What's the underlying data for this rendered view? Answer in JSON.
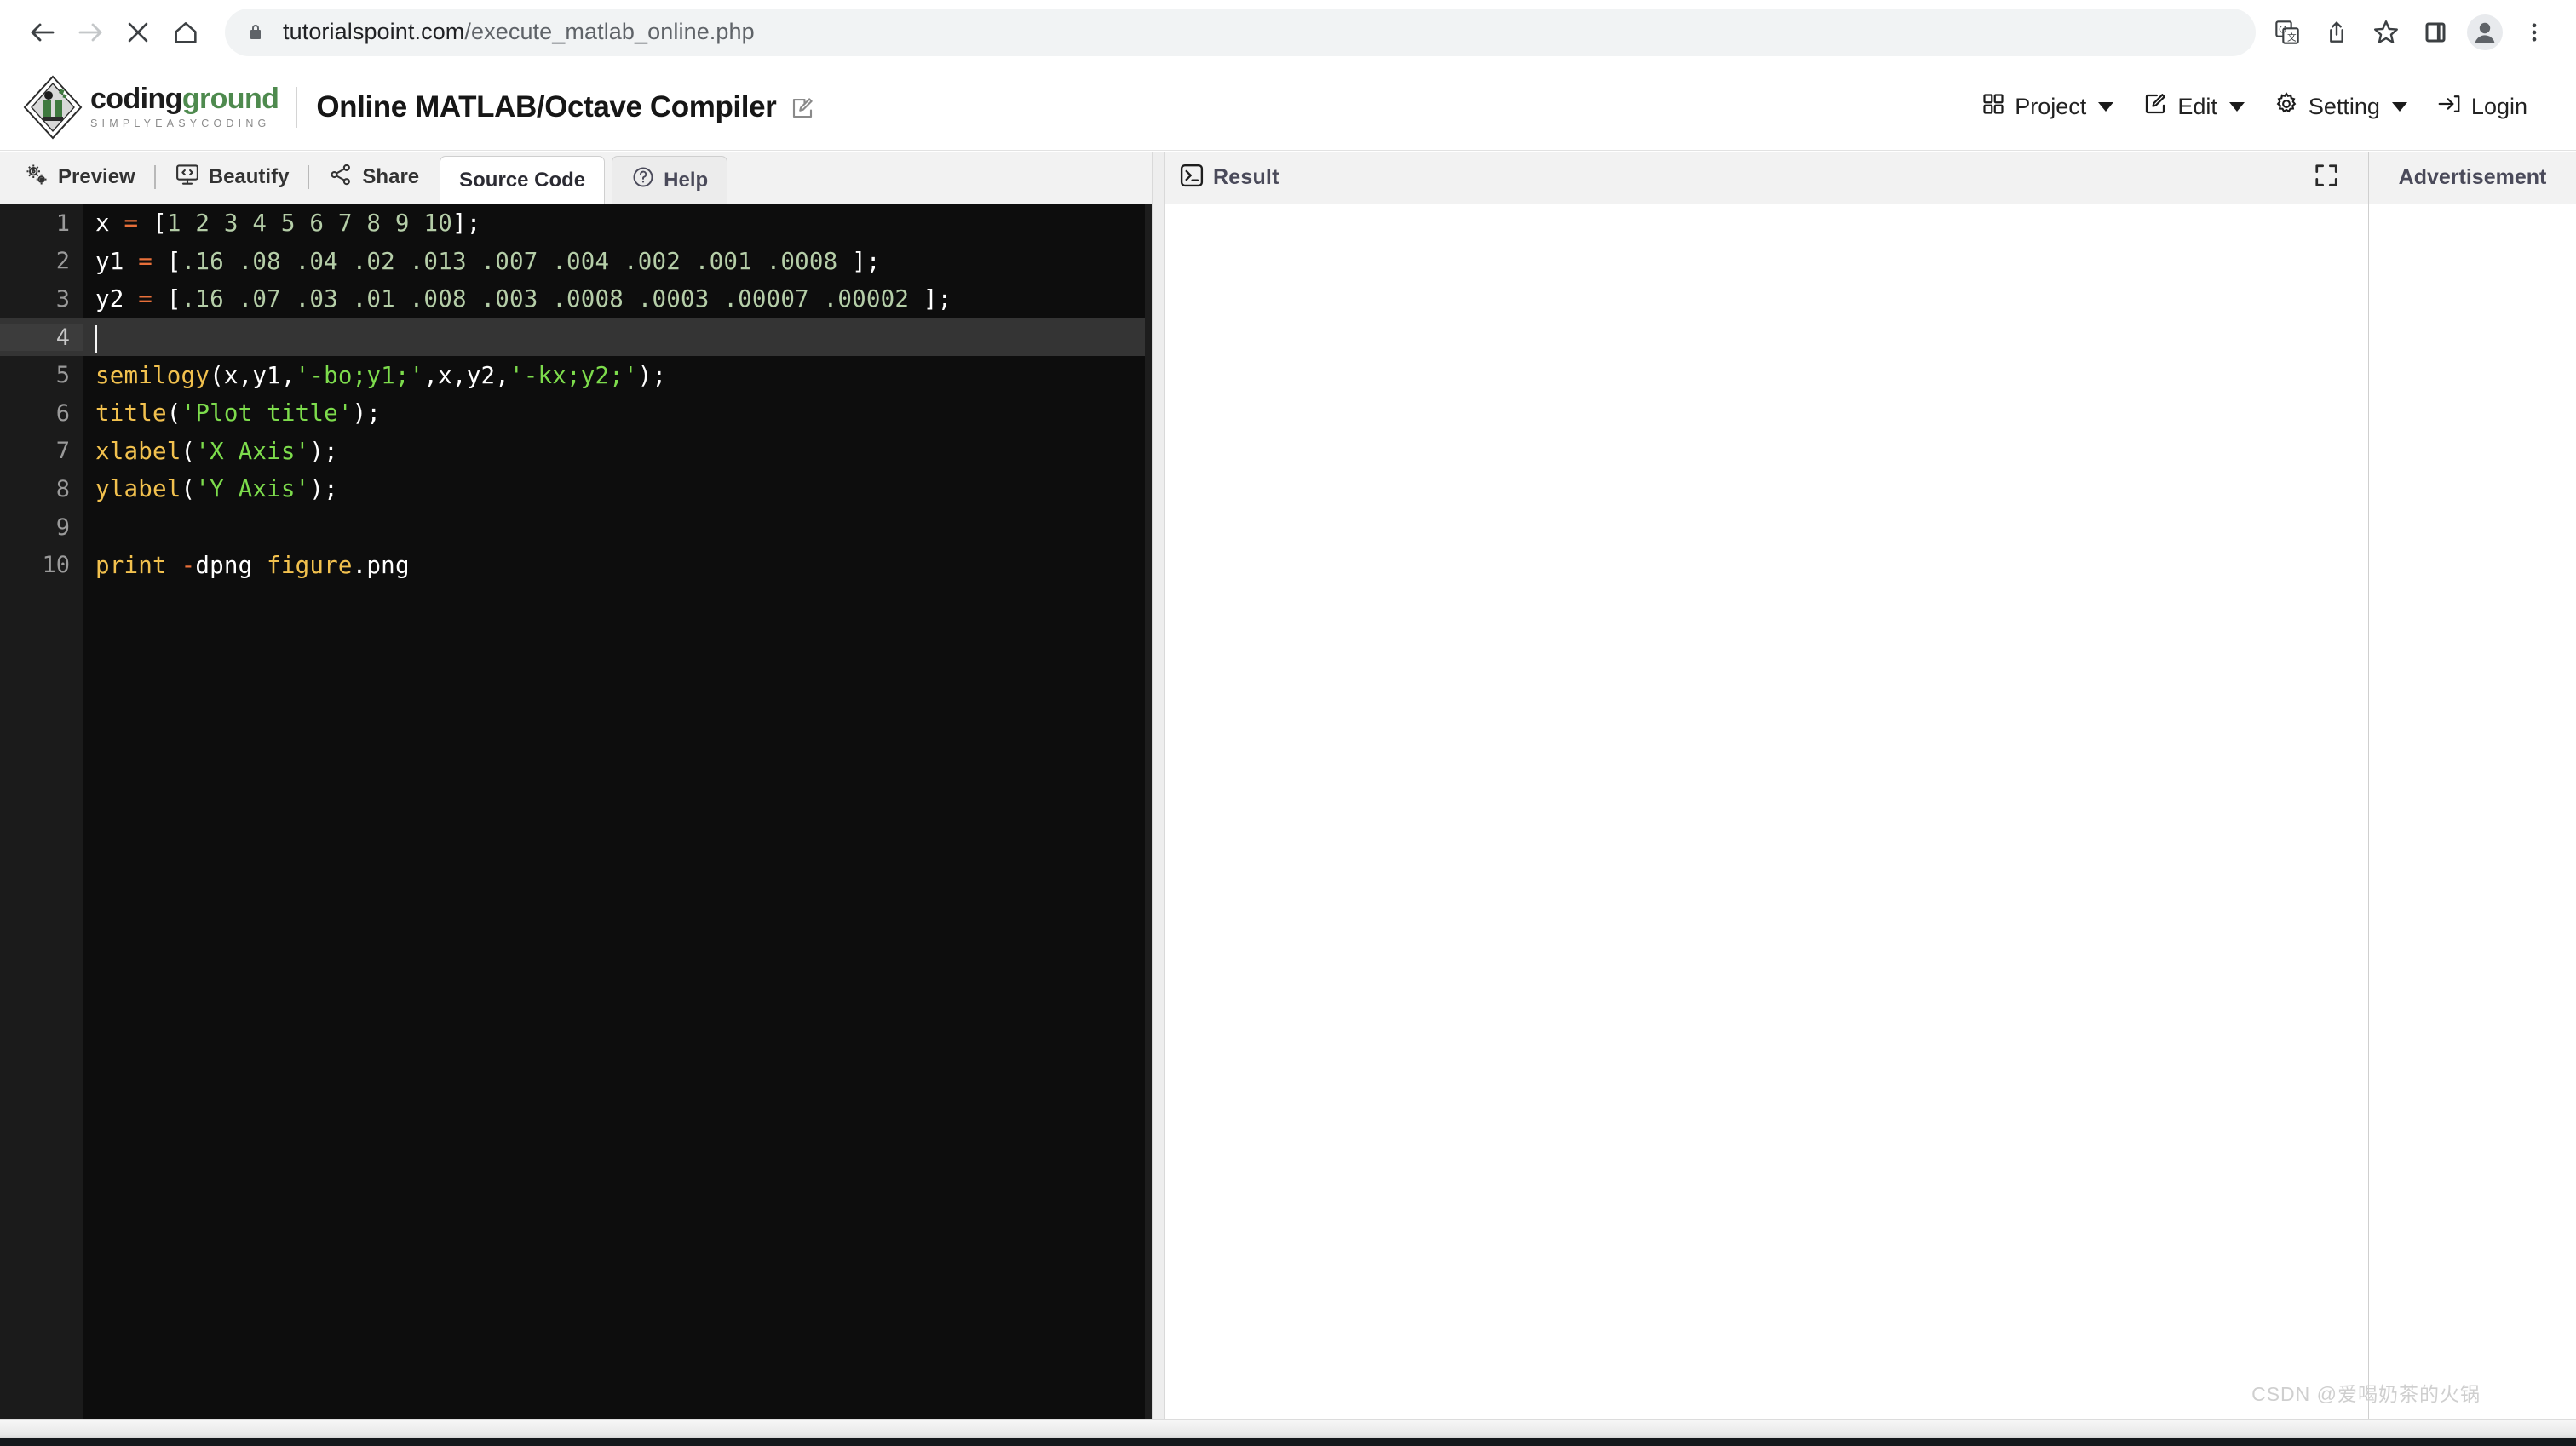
{
  "browser": {
    "url_domain": "tutorialspoint.com",
    "url_path": "/execute_matlab_online.php",
    "back_icon": "back-arrow-icon",
    "forward_icon": "forward-arrow-icon",
    "stop_icon": "stop-x-icon",
    "home_icon": "home-icon",
    "lock_icon": "lock-icon",
    "translate_icon": "translate-icon",
    "share_icon": "share-icon",
    "bookmark_icon": "star-icon",
    "sidepanel_icon": "side-panel-icon",
    "profile_icon": "profile-avatar-icon",
    "menu_icon": "three-dot-menu-icon"
  },
  "header": {
    "brand_name_part1": "coding",
    "brand_name_part2": "ground",
    "brand_tagline": "SIMPLYEASYCODING",
    "app_title": "Online MATLAB/Octave Compiler",
    "edit_title_icon": "pencil-square-icon",
    "nav": [
      {
        "label": "Project",
        "icon": "grid-squares-icon",
        "has_caret": true
      },
      {
        "label": "Edit",
        "icon": "pencil-square-icon",
        "has_caret": true
      },
      {
        "label": "Setting",
        "icon": "gear-icon",
        "has_caret": true
      },
      {
        "label": "Login",
        "icon": "login-arrow-icon",
        "has_caret": false
      }
    ]
  },
  "toolbar": {
    "buttons": [
      {
        "label": "Preview",
        "icon": "gears-icon"
      },
      {
        "label": "Beautify",
        "icon": "monitor-code-icon"
      },
      {
        "label": "Share",
        "icon": "share-nodes-icon"
      }
    ],
    "tabs": [
      {
        "label": "Source Code",
        "icon": "",
        "active": true
      },
      {
        "label": "Help",
        "icon": "question-circle-icon",
        "active": false
      }
    ]
  },
  "editor": {
    "active_line": 4,
    "lines": [
      {
        "n": "1",
        "tokens": [
          {
            "t": "var",
            "v": "x"
          },
          {
            "t": "plain",
            "v": " "
          },
          {
            "t": "op",
            "v": "="
          },
          {
            "t": "plain",
            "v": " "
          },
          {
            "t": "punc",
            "v": "["
          },
          {
            "t": "num",
            "v": "1 2 3 4 5 6 7 8 9 10"
          },
          {
            "t": "punc",
            "v": "];"
          }
        ]
      },
      {
        "n": "2",
        "tokens": [
          {
            "t": "var",
            "v": "y1"
          },
          {
            "t": "plain",
            "v": " "
          },
          {
            "t": "op",
            "v": "="
          },
          {
            "t": "plain",
            "v": " "
          },
          {
            "t": "punc",
            "v": "["
          },
          {
            "t": "num",
            "v": ".16 .08 .04 .02 .013 .007 .004 .002 .001 .0008 "
          },
          {
            "t": "punc",
            "v": "];"
          }
        ]
      },
      {
        "n": "3",
        "tokens": [
          {
            "t": "var",
            "v": "y2"
          },
          {
            "t": "plain",
            "v": " "
          },
          {
            "t": "op",
            "v": "="
          },
          {
            "t": "plain",
            "v": " "
          },
          {
            "t": "punc",
            "v": "["
          },
          {
            "t": "num",
            "v": ".16 .07 .03 .01 .008 .003 .0008 .0003 .00007 .00002 "
          },
          {
            "t": "punc",
            "v": "];"
          }
        ]
      },
      {
        "n": "4",
        "tokens": []
      },
      {
        "n": "5",
        "tokens": [
          {
            "t": "fn",
            "v": "semilogy"
          },
          {
            "t": "punc",
            "v": "(x,y1,"
          },
          {
            "t": "str",
            "v": "'-bo;y1;'"
          },
          {
            "t": "punc",
            "v": ",x,y2,"
          },
          {
            "t": "str",
            "v": "'-kx;y2;'"
          },
          {
            "t": "punc",
            "v": ");"
          }
        ]
      },
      {
        "n": "6",
        "tokens": [
          {
            "t": "fn",
            "v": "title"
          },
          {
            "t": "punc",
            "v": "("
          },
          {
            "t": "str",
            "v": "'Plot title'"
          },
          {
            "t": "punc",
            "v": ");"
          }
        ]
      },
      {
        "n": "7",
        "tokens": [
          {
            "t": "fn",
            "v": "xlabel"
          },
          {
            "t": "punc",
            "v": "("
          },
          {
            "t": "str",
            "v": "'X Axis'"
          },
          {
            "t": "punc",
            "v": ");"
          }
        ]
      },
      {
        "n": "8",
        "tokens": [
          {
            "t": "fn",
            "v": "ylabel"
          },
          {
            "t": "punc",
            "v": "("
          },
          {
            "t": "str",
            "v": "'Y Axis'"
          },
          {
            "t": "punc",
            "v": ");"
          }
        ]
      },
      {
        "n": "9",
        "tokens": []
      },
      {
        "n": "10",
        "tokens": [
          {
            "t": "fn",
            "v": "print"
          },
          {
            "t": "plain",
            "v": " "
          },
          {
            "t": "flag",
            "v": "-"
          },
          {
            "t": "punc",
            "v": "dpng"
          },
          {
            "t": "plain",
            "v": " "
          },
          {
            "t": "fn",
            "v": "figure"
          },
          {
            "t": "punc",
            "v": ".png"
          }
        ]
      }
    ]
  },
  "result": {
    "title": "Result",
    "terminal_icon": "terminal-prompt-icon",
    "expand_icon": "fullscreen-expand-icon",
    "output": ""
  },
  "advertisement": {
    "title": "Advertisement"
  },
  "watermark": {
    "text": "CSDN @爱喝奶茶的火锅"
  },
  "colors": {
    "toolbar_bg": "#f2f2f2",
    "editor_bg": "#0d0d0d",
    "gutter_bg": "#1b1b1b",
    "active_line_bg": "#343434",
    "token_function": "#f2c14e",
    "token_string": "#7ddc4c",
    "token_number": "#b5cea8",
    "token_operator": "#e8703a",
    "brand_green": "#4e8a4e"
  }
}
